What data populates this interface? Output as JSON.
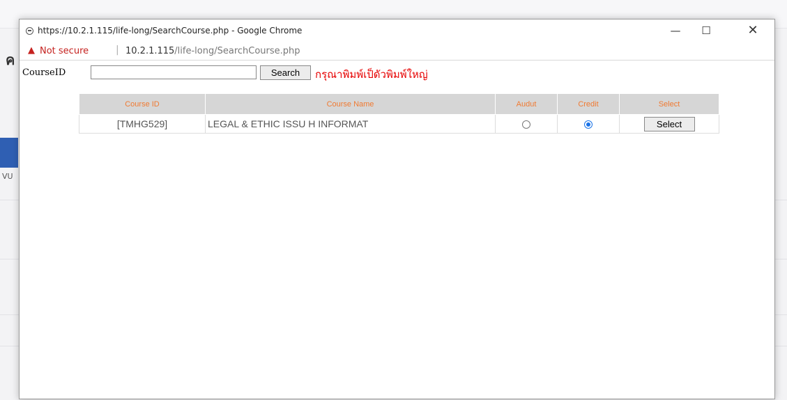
{
  "window": {
    "title": "https://10.2.1.115/life-long/SearchCourse.php - Google Chrome",
    "minimize_glyph": "—",
    "maximize_glyph": "☐",
    "close_glyph": "✕"
  },
  "address_bar": {
    "security_label": "Not secure",
    "host": "10.2.1.115",
    "path": "/life-long/SearchCourse.php"
  },
  "search": {
    "label": "CourseID",
    "value": "",
    "button_label": "Search",
    "hint": "กรุณาพิมพ์เป็ดัวพิมพ์ใหญ่"
  },
  "table": {
    "headers": [
      "Course ID",
      "Course Name",
      "Audut",
      "Credit",
      "Select"
    ],
    "rows": [
      {
        "course_id": "[TMHG529]",
        "course_name": "LEGAL & ETHIC ISSU H INFORMAT",
        "audit_selected": false,
        "credit_selected": true,
        "select_label": "Select"
      }
    ]
  },
  "background": {
    "glyph": "ค",
    "side_text": "VU"
  },
  "colors": {
    "header_text": "#f07a32",
    "hint_text": "#e60000",
    "not_secure": "#c5221f",
    "radio_checked": "#1a73e8"
  }
}
